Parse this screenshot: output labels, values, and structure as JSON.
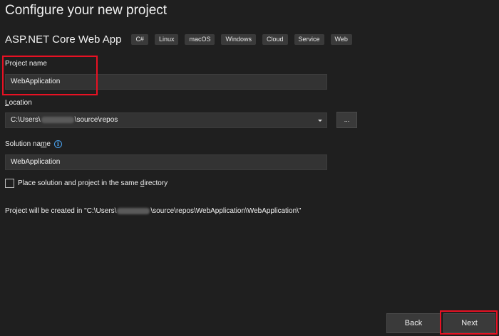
{
  "header": {
    "title": "Configure your new project"
  },
  "template": {
    "name": "ASP.NET Core Web App",
    "tags": [
      "C#",
      "Linux",
      "macOS",
      "Windows",
      "Cloud",
      "Service",
      "Web"
    ]
  },
  "project_name": {
    "label": "Project name",
    "value": "WebApplication"
  },
  "location": {
    "label_underlined": "L",
    "label_rest": "ocation",
    "value_prefix": "C:\\Users\\",
    "value_suffix": "\\source\\repos",
    "browse_label": "..."
  },
  "solution_name": {
    "label_before": "Solution na",
    "label_underlined": "m",
    "label_after": "e",
    "value": "WebApplication",
    "info_glyph": "i"
  },
  "same_directory": {
    "label_before": "Place solution and project in the same ",
    "label_underlined": "d",
    "label_after": "irectory",
    "checked": false
  },
  "created_path": {
    "prefix": "Project will be created in \"C:\\Users\\",
    "suffix": "\\source\\repos\\WebApplication\\WebApplication\\\""
  },
  "footer": {
    "back_label": "Back",
    "next_label": "Next"
  },
  "colors": {
    "background": "#1f1f1f",
    "field": "#333333",
    "highlight": "#e81123",
    "info": "#4aa3f0"
  }
}
